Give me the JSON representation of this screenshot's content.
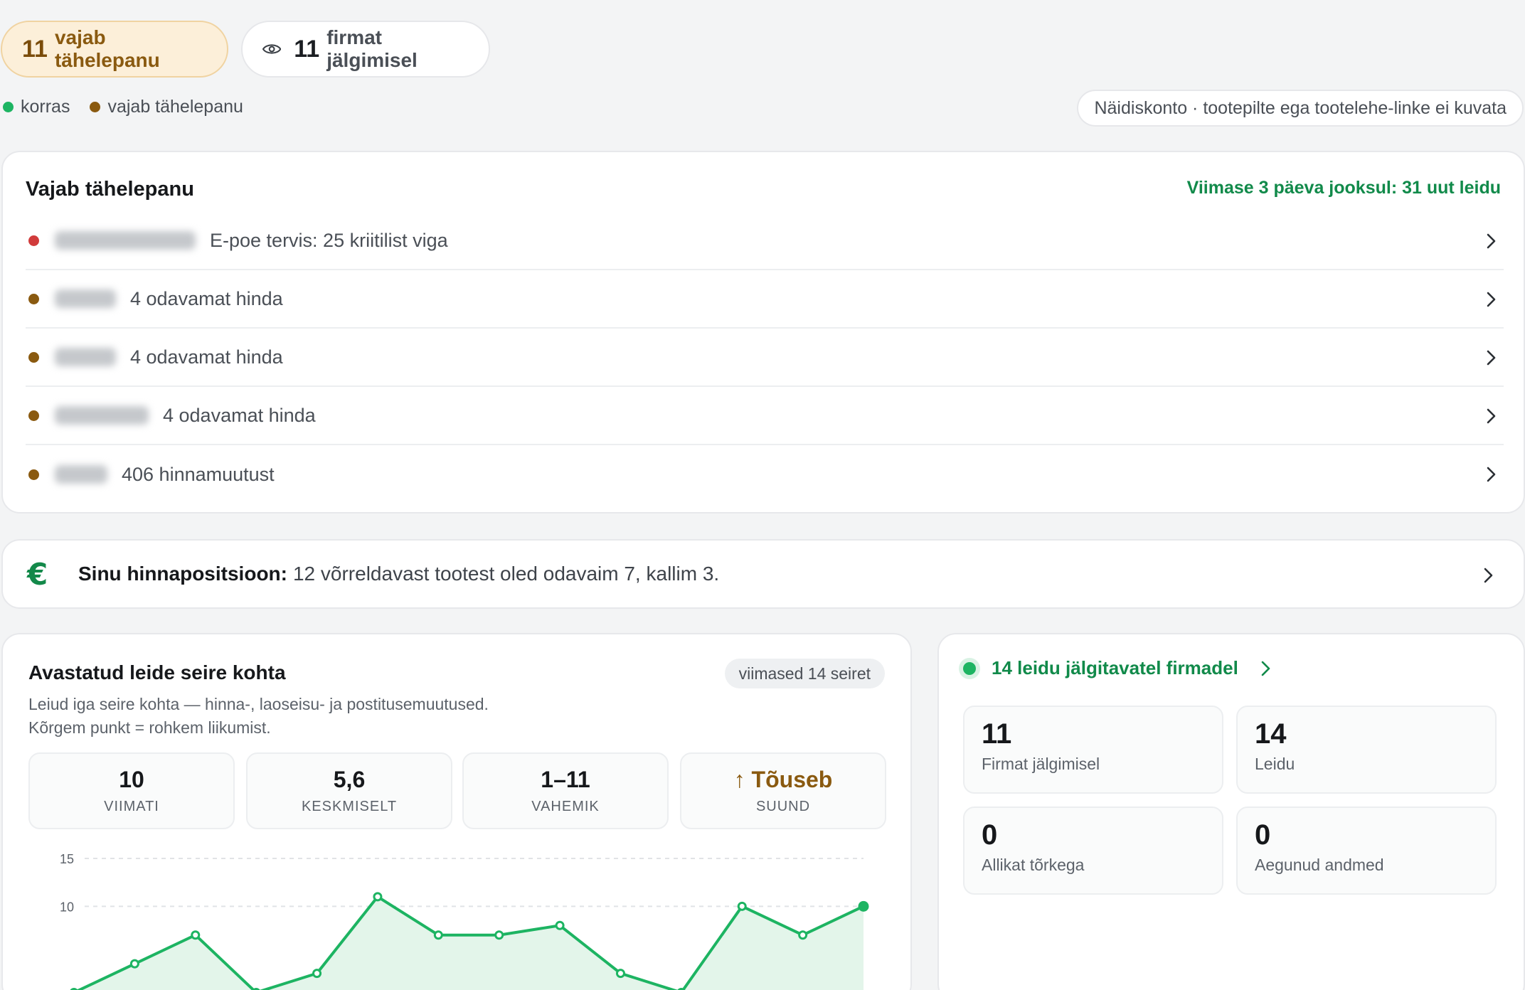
{
  "header": {
    "attention_count": "11",
    "attention_label": "vajab tähelepanu",
    "watched_count": "11",
    "watched_label": "firmat jälgimisel"
  },
  "legend": {
    "ok_label": "korras",
    "warn_label": "vajab tähelepanu"
  },
  "notice": "Näidiskonto · tootepilte ega tootelehe-linke ei kuvata",
  "colors": {
    "ok": "#1db462",
    "warn": "#8a5a10",
    "critical": "#d13b3b",
    "accent": "#118a4a"
  },
  "attention": {
    "title": "Vajab tähelepanu",
    "recent": "Viimase 3 päeva jooksul: 31 uut leidu",
    "items": [
      {
        "status": "critical",
        "text": "E-poe tervis: 25 kriitilist viga"
      },
      {
        "status": "warn",
        "text": "4 odavamat hinda"
      },
      {
        "status": "warn",
        "text": "4 odavamat hinda"
      },
      {
        "status": "warn",
        "text": "4 odavamat hinda"
      },
      {
        "status": "warn",
        "text": "406 hinnamuutust"
      }
    ]
  },
  "price_position": {
    "icon": "euro-icon",
    "label": "Sinu hinnapositsioon:",
    "text": "12 võrreldavast tootest oled odavaim 7, kallim 3."
  },
  "findings_chart": {
    "title": "Avastatud leide seire kohta",
    "badge": "viimased 14 seiret",
    "description": "Leiud iga seire kohta — hinna-, laoseisu- ja postitusemuutused. Kõrgem punkt = rohkem liikumist.",
    "stats": [
      {
        "value": "10",
        "label": "VIIMATI"
      },
      {
        "value": "5,6",
        "label": "KESKMISELT"
      },
      {
        "value": "1–11",
        "label": "VAHEMIK"
      },
      {
        "value": "↑ Tõuseb",
        "label": "SUUND"
      }
    ]
  },
  "chart_data": {
    "type": "area",
    "title": "Avastatud leide seire kohta",
    "xlabel": "",
    "ylabel": "",
    "ylim": [
      0,
      15
    ],
    "yticks": [
      "15",
      "10"
    ],
    "x": [
      1,
      2,
      3,
      4,
      5,
      6,
      7,
      8,
      9,
      10,
      11,
      12,
      13,
      14
    ],
    "series": [
      {
        "values": [
          1,
          4,
          7,
          1,
          3,
          11,
          7,
          7,
          8,
          3,
          1,
          10,
          7,
          10
        ]
      }
    ]
  },
  "findings_summary": {
    "head": "14 leidu jälgitavatel firmadel",
    "boxes": [
      {
        "value": "11",
        "label": "Firmat jälgimisel"
      },
      {
        "value": "14",
        "label": "Leidu"
      },
      {
        "value": "0",
        "label": "Allikat tõrkega"
      },
      {
        "value": "0",
        "label": "Aegunud andmed"
      }
    ]
  }
}
